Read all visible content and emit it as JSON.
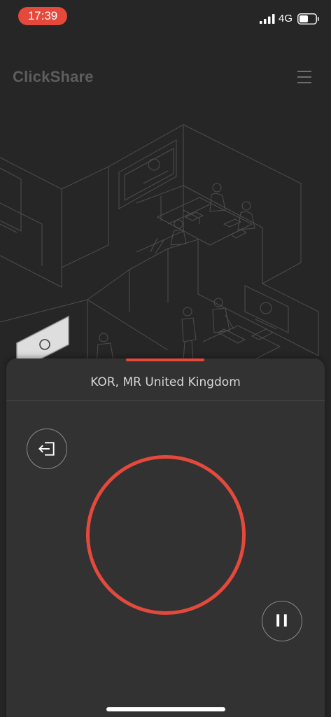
{
  "status_bar": {
    "time": "17:39",
    "network": "4G",
    "signal_icon": "cellular-signal-icon",
    "battery_icon": "battery-icon",
    "time_pill_color": "#e5493c"
  },
  "header": {
    "logo": "ClickShare",
    "menu_icon": "hamburger-menu-icon"
  },
  "panel": {
    "room_name": "KOR, MR United Kingdom",
    "leave_icon": "leave-room-icon",
    "share_button_icon": "share-circle",
    "pause_icon": "pause-icon",
    "accent_color": "#e5493c"
  }
}
